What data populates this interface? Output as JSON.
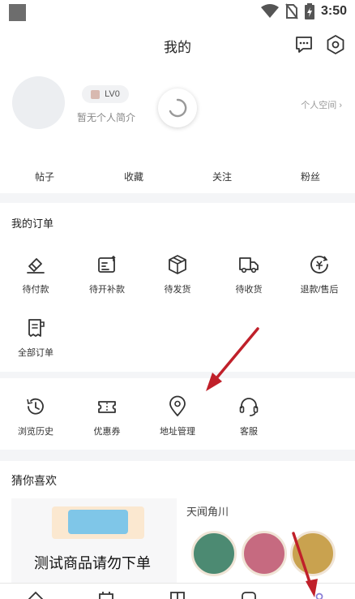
{
  "status_bar": {
    "time": "3:50"
  },
  "header": {
    "title": "我的"
  },
  "profile": {
    "level": "LV0",
    "bio": "暂无个人简介",
    "space_link": "个人空间 ›",
    "stats": [
      "帖子",
      "收藏",
      "关注",
      "粉丝"
    ]
  },
  "orders": {
    "title": "我的订单",
    "items": [
      {
        "label": "待付款",
        "icon": "wallet-icon"
      },
      {
        "label": "待开补款",
        "icon": "invoice-icon"
      },
      {
        "label": "待发货",
        "icon": "box-icon"
      },
      {
        "label": "待收货",
        "icon": "truck-icon"
      },
      {
        "label": "退款/售后",
        "icon": "refund-icon"
      },
      {
        "label": "全部订单",
        "icon": "receipt-icon"
      }
    ]
  },
  "tools": {
    "items": [
      {
        "label": "浏览历史",
        "icon": "history-icon"
      },
      {
        "label": "优惠券",
        "icon": "coupon-icon"
      },
      {
        "label": "地址管理",
        "icon": "location-icon"
      },
      {
        "label": "客服",
        "icon": "headset-icon"
      }
    ]
  },
  "recommend": {
    "title": "猜你喜欢",
    "product_left_title": "测试商品请勿下单",
    "product_right_brand": "天闻角川"
  },
  "colors": {
    "accent": "#8a7fd6",
    "arrow": "#c0202a"
  }
}
